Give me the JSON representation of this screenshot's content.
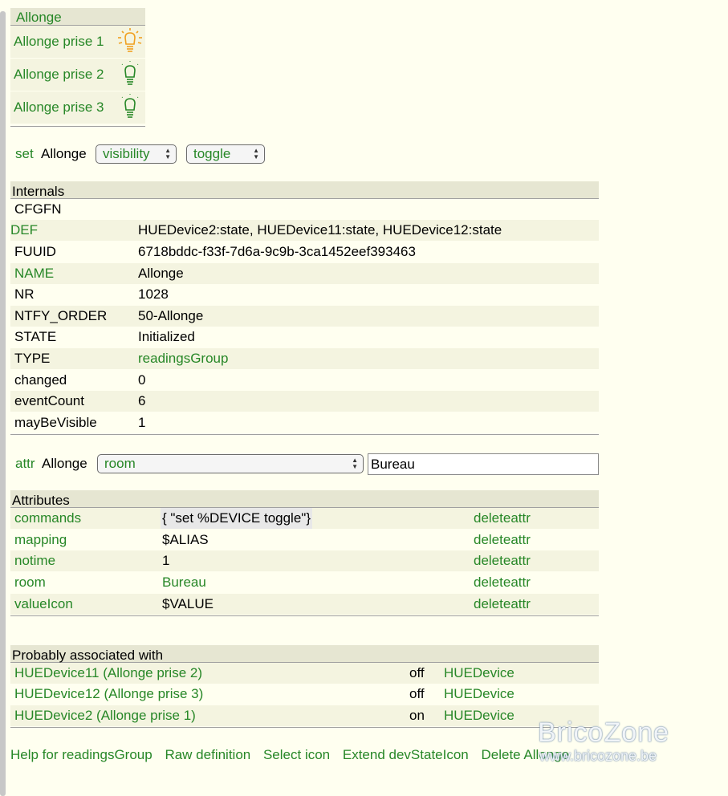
{
  "group": {
    "title": "Allonge",
    "items": [
      {
        "label": "Allonge prise 1",
        "state": "on"
      },
      {
        "label": "Allonge prise 2",
        "state": "off"
      },
      {
        "label": "Allonge prise 3",
        "state": "off"
      }
    ]
  },
  "set_row": {
    "cmd": "set",
    "device": "Allonge",
    "select1": "visibility",
    "select2": "toggle"
  },
  "internals": {
    "header": "Internals",
    "rows": [
      {
        "key": "CFGFN",
        "value": ""
      },
      {
        "key": "DEF",
        "value": "HUEDevice2:state, HUEDevice11:state, HUEDevice12:state"
      },
      {
        "key": "FUUID",
        "value": "6718bddc-f33f-7d6a-9c9b-3ca1452eef393463"
      },
      {
        "key": "NAME",
        "value": "Allonge"
      },
      {
        "key": "NR",
        "value": "1028"
      },
      {
        "key": "NTFY_ORDER",
        "value": "50-Allonge"
      },
      {
        "key": "STATE",
        "value": "Initialized"
      },
      {
        "key": "TYPE",
        "value": "readingsGroup"
      },
      {
        "key": "changed",
        "value": "0"
      },
      {
        "key": "eventCount",
        "value": "6"
      },
      {
        "key": "mayBeVisible",
        "value": "1"
      }
    ]
  },
  "attr_row": {
    "cmd": "attr",
    "device": "Allonge",
    "select": "room",
    "input_value": "Bureau"
  },
  "attributes": {
    "header": "Attributes",
    "delete_label": "deleteattr",
    "rows": [
      {
        "key": "commands",
        "value": "{ \"set %DEVICE toggle\"}"
      },
      {
        "key": "mapping",
        "value": "$ALIAS"
      },
      {
        "key": "notime",
        "value": "1"
      },
      {
        "key": "room",
        "value": "Bureau"
      },
      {
        "key": "valueIcon",
        "value": "$VALUE"
      }
    ]
  },
  "associated": {
    "header": "Probably associated with",
    "rows": [
      {
        "name": "HUEDevice11 (Allonge prise 2)",
        "state": "off",
        "type": "HUEDevice"
      },
      {
        "name": "HUEDevice12 (Allonge prise 3)",
        "state": "off",
        "type": "HUEDevice"
      },
      {
        "name": "HUEDevice2 (Allonge prise 1)",
        "state": "on",
        "type": "HUEDevice"
      }
    ]
  },
  "links": [
    "Help for readingsGroup",
    "Raw definition",
    "Select icon",
    "Extend devStateIcon",
    "Delete Allonge"
  ],
  "watermark": {
    "brand": "BricoZone",
    "url": "www.bricozone.be"
  },
  "colors": {
    "link": "#278727",
    "header_bg": "#e6e6d2",
    "row_bg": "#f4f4e0",
    "page_bg": "#fffff0",
    "bulb_on": "#f0a020"
  }
}
